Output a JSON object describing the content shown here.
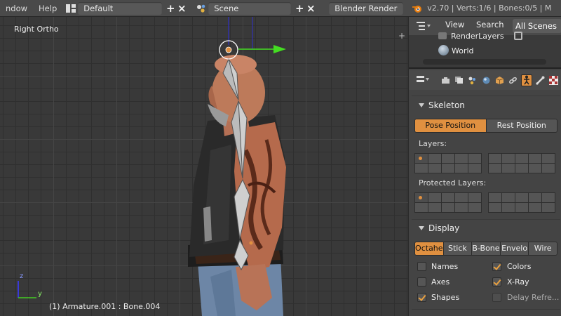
{
  "topbar": {
    "menu_window": "ndow",
    "menu_help": "Help",
    "layout_name": "Default",
    "scene_name": "Scene",
    "render_engine": "Blender Render",
    "stats": "v2.70 | Verts:1/6 | Bones:0/5 | M"
  },
  "viewport": {
    "view_name": "Right Ortho",
    "status": "(1) Armature.001 : Bone.004",
    "axis_z": "z",
    "axis_y": "y",
    "colors": {
      "manip_y": "#44dd22",
      "manip_z": "#2222dd",
      "bone": "#cfcfcf"
    }
  },
  "outliner": {
    "view_label": "View",
    "search_label": "Search",
    "filter_label": "All Scenes",
    "items": [
      "RenderLayers",
      "World"
    ]
  },
  "properties": {
    "tabs": [
      "render-icon",
      "render-layers-icon",
      "scene-icon",
      "world-icon",
      "object-icon",
      "constraints-icon",
      "armature-data-icon",
      "bone-icon",
      "texture-icon"
    ],
    "skeleton": {
      "title": "Skeleton",
      "pose_position": "Pose Position",
      "rest_position": "Rest Position",
      "layers_label": "Layers:",
      "protected_layers_label": "Protected Layers:"
    },
    "display": {
      "title": "Display",
      "modes": [
        "Octahe",
        "Stick",
        "B-Bone",
        "Envelo",
        "Wire"
      ],
      "names": {
        "label": "Names",
        "checked": false
      },
      "colors": {
        "label": "Colors",
        "checked": true
      },
      "axes": {
        "label": "Axes",
        "checked": false
      },
      "xray": {
        "label": "X-Ray",
        "checked": true
      },
      "shapes": {
        "label": "Shapes",
        "checked": true
      },
      "delay_refresh": {
        "label": "Delay Refre...",
        "checked": false
      }
    },
    "accent_color": "#e09040"
  }
}
